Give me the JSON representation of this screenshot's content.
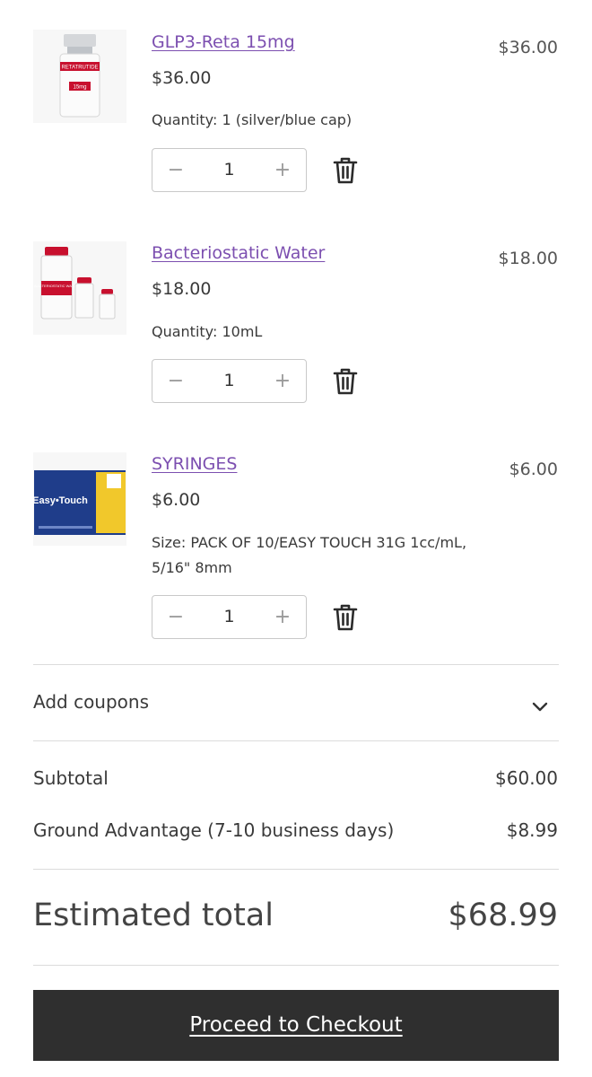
{
  "cart": {
    "items": [
      {
        "name": "GLP3-Reta 15mg",
        "unit_price": "$36.00",
        "meta_line1": "Quantity: 1 (silver/blue cap)",
        "meta_line2": "",
        "quantity": "1",
        "line_total": "$36.00",
        "image_label_main": "RETATRUTIDE",
        "image_label_dose": "15mg"
      },
      {
        "name": "Bacteriostatic Water",
        "unit_price": "$18.00",
        "meta_line1": "Quantity: 10mL",
        "meta_line2": "",
        "quantity": "1",
        "line_total": "$18.00",
        "image_label_main": "BACTERIOSTATIC WATER"
      },
      {
        "name": "SYRINGES",
        "unit_price": "$6.00",
        "meta_line1": "Size: PACK OF 10/EASY TOUCH 31G 1cc/mL,",
        "meta_line2": "5/16\" 8mm",
        "quantity": "1",
        "line_total": "$6.00",
        "image_label_main": "Easy•Touch"
      }
    ],
    "stepper": {
      "minus": "−",
      "plus": "+"
    }
  },
  "coupons": {
    "label": "Add coupons"
  },
  "totals": {
    "subtotal_label": "Subtotal",
    "subtotal_value": "$60.00",
    "shipping_label": "Ground Advantage (7-10 business days)",
    "shipping_value": "$8.99",
    "estimated_label": "Estimated total",
    "estimated_value": "$68.99"
  },
  "checkout": {
    "label": "Proceed to Checkout"
  },
  "icons": {
    "remove": "trash-icon",
    "expand": "chevron-down-icon"
  },
  "colors": {
    "link": "#7c4fb0",
    "button_bg": "#2f2f2f",
    "button_text": "#ffffff"
  }
}
